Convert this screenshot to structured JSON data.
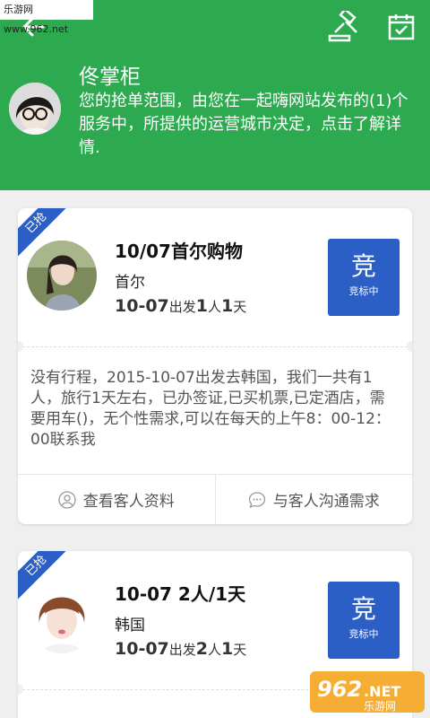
{
  "watermark_top": "乐游网 www.962.net",
  "header": {
    "name": "佟掌柜",
    "description": "您的抢单范围，由您在一起嗨网站发布的(1)个服务中，所提供的运营城市决定，点击了解详情."
  },
  "orders": [
    {
      "badge": "已抢",
      "title": "10/07首尔购物",
      "city": "首尔",
      "date": "10-07",
      "depart": "出发",
      "people": "1",
      "people_unit": "人",
      "days": "1",
      "days_unit": "天",
      "bid_char": "竞",
      "bid_status": "竞标中",
      "description": "没有行程，2015-10-07出发去韩国，我们一共有1人，旅行1天左右，已办签证,已买机票,已定酒店，需要用车()，无个性需求,可以在每天的上午8：00-12：00联系我",
      "action_profile": "查看客人资料",
      "action_chat": "与客人沟通需求"
    },
    {
      "badge": "已抢",
      "title": "10-07 2人/1天",
      "city": "韩国",
      "date": "10-07",
      "depart": "出发",
      "people": "2",
      "people_unit": "人",
      "days": "1",
      "days_unit": "天",
      "bid_char": "竞",
      "bid_status": "竞标中"
    }
  ],
  "watermark_bottom": {
    "num": "962",
    "suffix": ".NET",
    "cn": "乐游网"
  },
  "colors": {
    "header": "#2daa4f",
    "accent": "#2c5fc5"
  }
}
